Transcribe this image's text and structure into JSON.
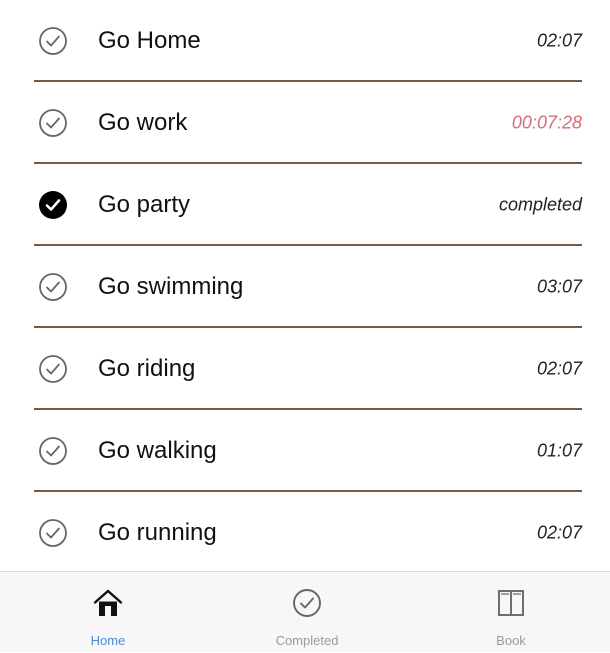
{
  "tasks": [
    {
      "title": "Go Home",
      "meta": "02:07",
      "completed": false,
      "meta_color": "#222222"
    },
    {
      "title": "Go work",
      "meta": "00:07:28",
      "completed": false,
      "meta_color": "#d66b79"
    },
    {
      "title": "Go party",
      "meta": "completed",
      "completed": true,
      "meta_color": "#222222"
    },
    {
      "title": "Go swimming",
      "meta": "03:07",
      "completed": false,
      "meta_color": "#222222"
    },
    {
      "title": "Go riding",
      "meta": "02:07",
      "completed": false,
      "meta_color": "#222222"
    },
    {
      "title": "Go walking",
      "meta": "01:07",
      "completed": false,
      "meta_color": "#222222"
    },
    {
      "title": "Go running",
      "meta": "02:07",
      "completed": false,
      "meta_color": "#222222"
    }
  ],
  "tabbar": {
    "items": [
      {
        "label": "Home",
        "icon": "home-icon",
        "active": true
      },
      {
        "label": "Completed",
        "icon": "check-circle-icon",
        "active": false
      },
      {
        "label": "Book",
        "icon": "book-icon",
        "active": false
      }
    ]
  },
  "colors": {
    "divider": "#7b5a43",
    "active_tab": "#4b8bd4",
    "inactive_tab": "#9a9a9a",
    "running_timer": "#d66b79"
  }
}
